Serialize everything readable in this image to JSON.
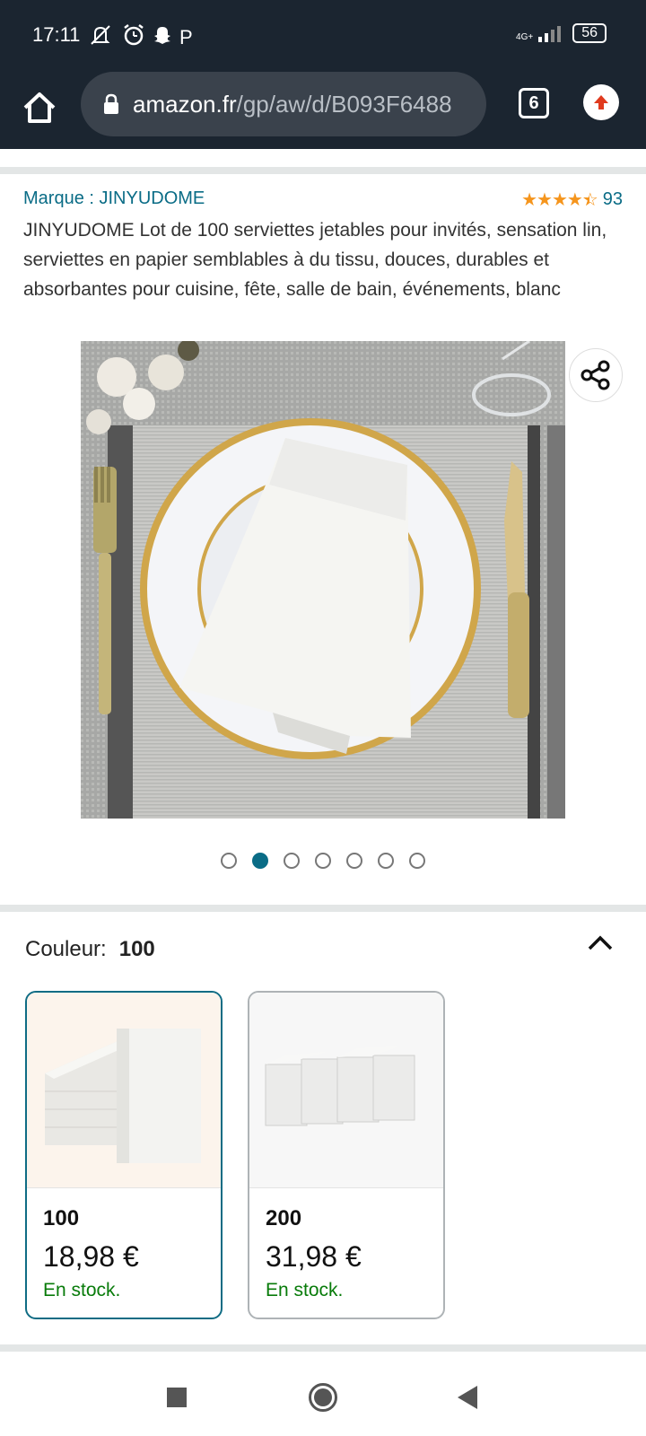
{
  "status_bar": {
    "time": "17:11",
    "left_icons": [
      "mute-icon",
      "alarm-icon",
      "snapchat-icon",
      "P"
    ],
    "network": "4G+",
    "battery": "56"
  },
  "browser": {
    "url_domain": "amazon.fr",
    "url_path": "/gp/aw/d/B093F6488",
    "tabs_count": "6"
  },
  "product": {
    "brand": "Marque : JINYUDOME",
    "rating_count": "93",
    "rating_stars": 4.5,
    "title": "JINYUDOME Lot de 100 serviettes jetables pour invités, sensation lin, serviettes en papier semblables à du tissu, douces, durables et absorbantes pour cuisine, fête, salle de bain, événements, blanc",
    "image_count": 7,
    "active_image": 2
  },
  "color_section": {
    "label": "Couleur:",
    "selected_value": "100",
    "variants": [
      {
        "name": "100",
        "price": "18,98 €",
        "stock": "En stock."
      },
      {
        "name": "200",
        "price": "31,98 €",
        "stock": "En stock."
      }
    ]
  },
  "colors": {
    "status_bar_bg": "#1b2530",
    "link_teal": "#0a6c86",
    "star_orange": "#f5951d",
    "stock_green": "#087b0a"
  }
}
